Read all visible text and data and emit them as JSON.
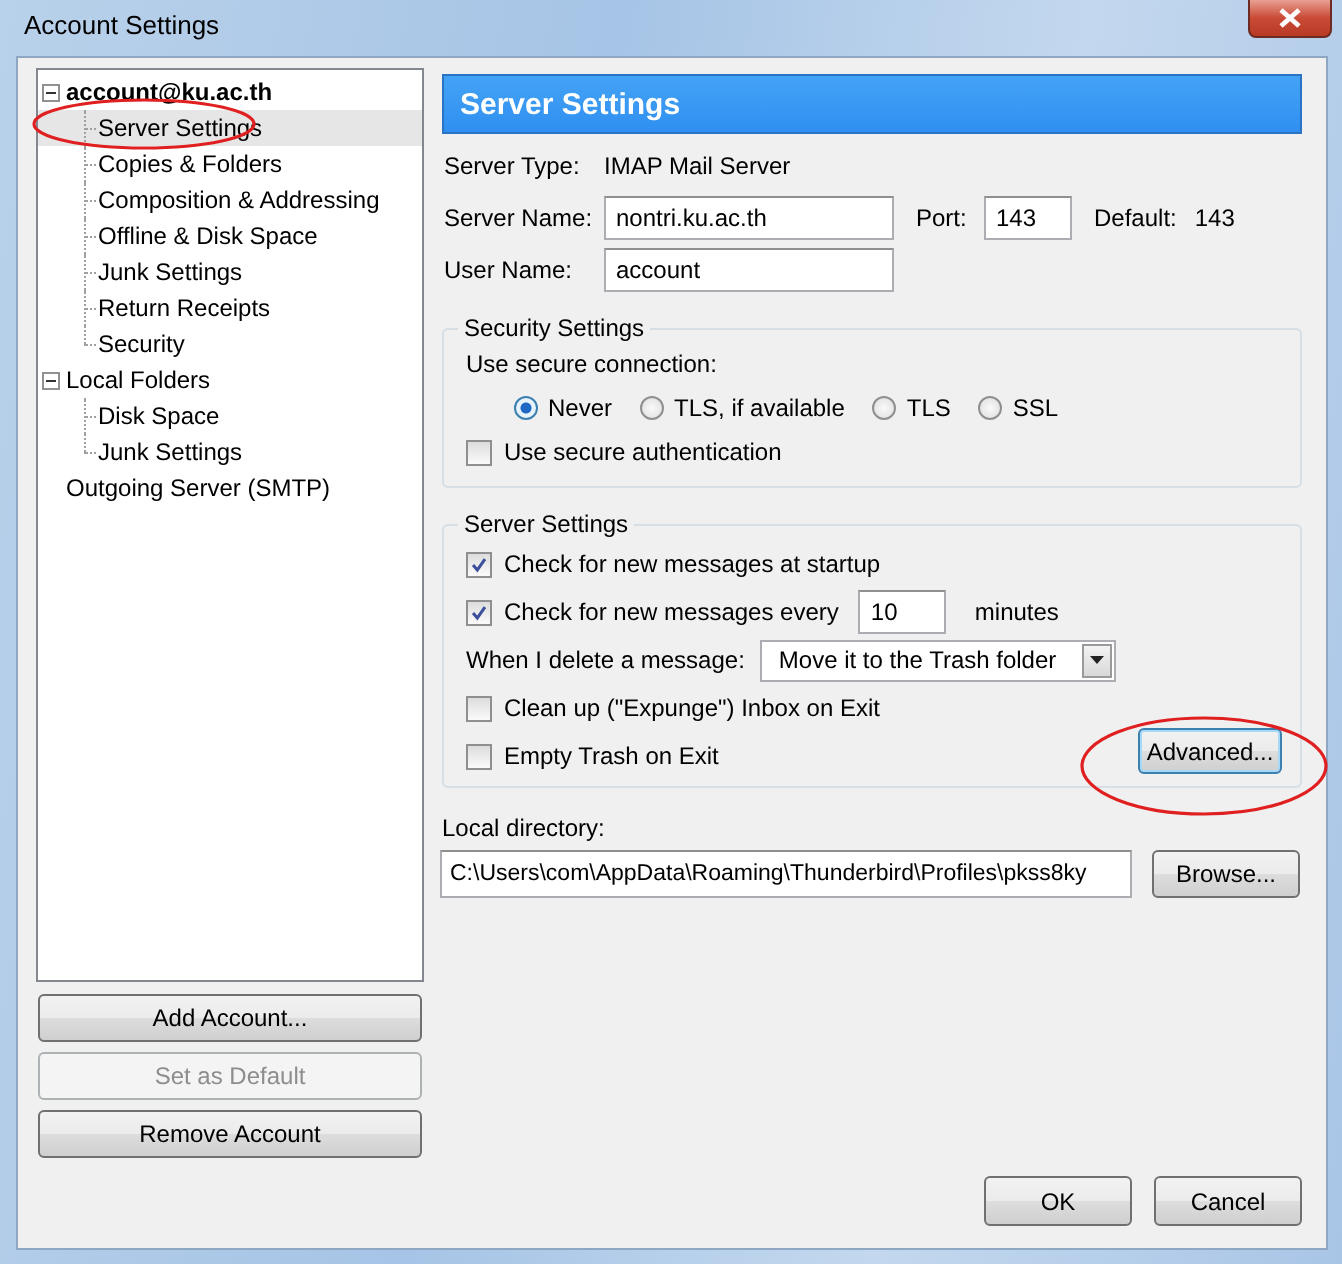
{
  "window": {
    "title": "Account Settings"
  },
  "tree": [
    {
      "label": "account@ku.ac.th",
      "bold": true,
      "expanded": true,
      "selected": false,
      "children": [
        {
          "label": "Server Settings",
          "selected": true
        },
        {
          "label": "Copies & Folders",
          "selected": false
        },
        {
          "label": "Composition & Addressing",
          "selected": false
        },
        {
          "label": "Offline & Disk Space",
          "selected": false
        },
        {
          "label": "Junk Settings",
          "selected": false
        },
        {
          "label": "Return Receipts",
          "selected": false
        },
        {
          "label": "Security",
          "selected": false
        }
      ]
    },
    {
      "label": "Local Folders",
      "bold": false,
      "expanded": true,
      "selected": false,
      "children": [
        {
          "label": "Disk Space",
          "selected": false
        },
        {
          "label": "Junk Settings",
          "selected": false
        }
      ]
    },
    {
      "label": "Outgoing Server (SMTP)",
      "bold": false,
      "selected": false
    }
  ],
  "account_buttons": [
    {
      "label": "Add Account...",
      "disabled": false
    },
    {
      "label": "Set as Default",
      "disabled": true
    },
    {
      "label": "Remove Account",
      "disabled": false
    }
  ],
  "panel": {
    "title": "Server Settings",
    "server_type": {
      "label": "Server Type:",
      "value": "IMAP Mail Server"
    },
    "server_name": {
      "label": "Server Name:",
      "value": "nontri.ku.ac.th"
    },
    "port": {
      "label": "Port:",
      "value": "143"
    },
    "default_port": {
      "label": "Default:",
      "value": "143"
    },
    "user_name": {
      "label": "User Name:",
      "value": "account"
    },
    "security": {
      "title": "Security Settings",
      "connection_label": "Use secure connection:",
      "options": [
        {
          "label": "Never",
          "selected": true
        },
        {
          "label": "TLS, if available",
          "selected": false
        },
        {
          "label": "TLS",
          "selected": false
        },
        {
          "label": "SSL",
          "selected": false
        }
      ],
      "secure_auth": {
        "label": "Use secure authentication",
        "checked": false
      }
    },
    "server_settings": {
      "title": "Server Settings",
      "check_startup": {
        "label": "Check for new messages at startup",
        "checked": true
      },
      "check_every": {
        "label": "Check for new messages every",
        "checked": true,
        "value": "10",
        "unit": "minutes"
      },
      "delete_action": {
        "label": "When I delete a message:",
        "value": "Move it to the Trash folder"
      },
      "exit_options": [
        {
          "label": "Clean up (\"Expunge\") Inbox on Exit",
          "checked": false
        },
        {
          "label": "Empty Trash on Exit",
          "checked": false
        }
      ],
      "advanced_button": "Advanced..."
    },
    "local_directory": {
      "label": "Local directory:",
      "value": "C:\\Users\\com\\AppData\\Roaming\\Thunderbird\\Profiles\\pkss8ky",
      "button": "Browse..."
    }
  },
  "dialog_buttons": [
    "OK",
    "Cancel"
  ]
}
